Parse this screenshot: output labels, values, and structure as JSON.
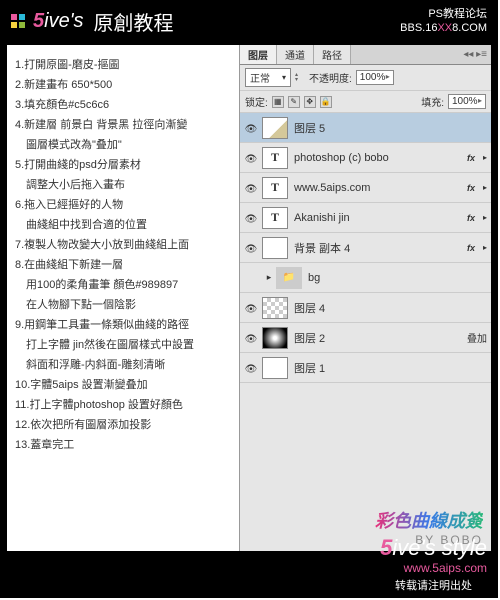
{
  "header": {
    "brand_num": "5",
    "brand_txt": "ive's",
    "title_zh": "原創教程",
    "forum_line1": "PS教程论坛",
    "forum_line2a": "BBS.16",
    "forum_line2b": "XX",
    "forum_line2c": "8.COM"
  },
  "steps": [
    "1.打開原圖-磨皮-摳圖",
    "2.新建畫布 650*500",
    "3.填充顏色#c5c6c6",
    "4.新建層 前景白 背景黑 拉徑向漸變",
    "　圖層模式改為\"叠加\"",
    "5.打開曲綫的psd分層素材",
    "　調整大小后拖入畫布",
    "6.拖入已經摳好的人物",
    "　曲綫組中找到合適的位置",
    "7.複製人物改變大小放到曲綫組上面",
    "8.在曲綫組下新建一層",
    "　用100的柔角畫筆 顏色#989897",
    "　在人物腳下點一個陰影",
    "9.用鋼筆工具畫一條類似曲綫的路徑",
    "　打上字體 jin然後在圖層樣式中設置",
    "　斜面和浮雕-内斜面-雕刻清晰",
    "10.字體5aips 設置漸變叠加",
    "11.打上字體photoshop 設置好顏色",
    "12.依次把所有圖層添加投影",
    "13.蓋章完工"
  ],
  "panel": {
    "tabs": {
      "layers": "图层",
      "channels": "通道",
      "paths": "路径"
    },
    "mode_label": "正常",
    "opacity_label": "不透明度:",
    "opacity_val": "100%",
    "lock_label": "锁定:",
    "fill_label": "填充:",
    "fill_val": "100%"
  },
  "layers": [
    {
      "name": "图层 5",
      "type": "img",
      "sel": true,
      "fx": false,
      "blend": ""
    },
    {
      "name": "photoshop (c) bobo",
      "type": "T",
      "fx": true,
      "blend": ""
    },
    {
      "name": "www.5aips.com",
      "type": "T",
      "fx": true,
      "blend": ""
    },
    {
      "name": "Akanishi jin",
      "type": "T",
      "fx": true,
      "blend": ""
    },
    {
      "name": "背景 副本 4",
      "type": "wht",
      "fx": true,
      "blend": ""
    },
    {
      "name": "bg",
      "type": "fold",
      "fx": false,
      "blend": "",
      "eye": "off"
    },
    {
      "name": "图层 4",
      "type": "chk",
      "fx": false,
      "blend": ""
    },
    {
      "name": "图层 2",
      "type": "grad",
      "fx": false,
      "blend": "叠加"
    },
    {
      "name": "图层 1",
      "type": "wht",
      "fx": false,
      "blend": ""
    }
  ],
  "signature": {
    "line1": "彩色曲線成簽",
    "line2": "BY BOBO"
  },
  "footer": {
    "brand_num": "5",
    "brand_txt": "ive's style",
    "url": "www.5aips.com",
    "note": "转载请注明出处"
  }
}
